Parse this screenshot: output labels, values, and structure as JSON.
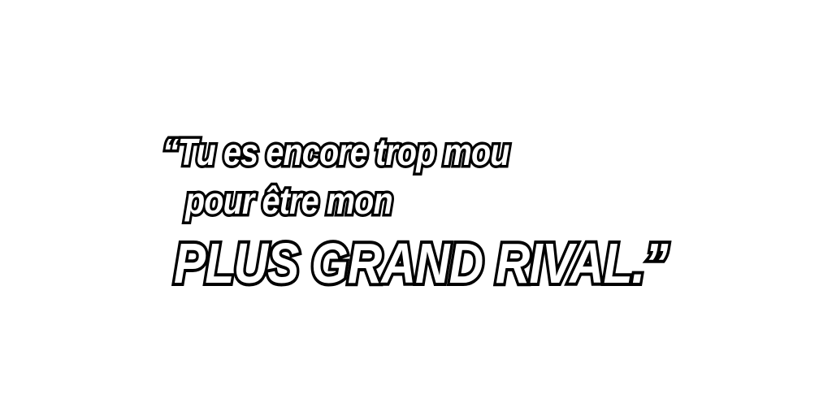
{
  "quote": {
    "line1": "“Tu es encore trop mou",
    "line2": "pour être mon",
    "line3": "PLUS GRAND RIVAL.”"
  },
  "colors": {
    "background": "#ffffff",
    "text_fill": "#ffffff",
    "text_outline": "#000000"
  }
}
